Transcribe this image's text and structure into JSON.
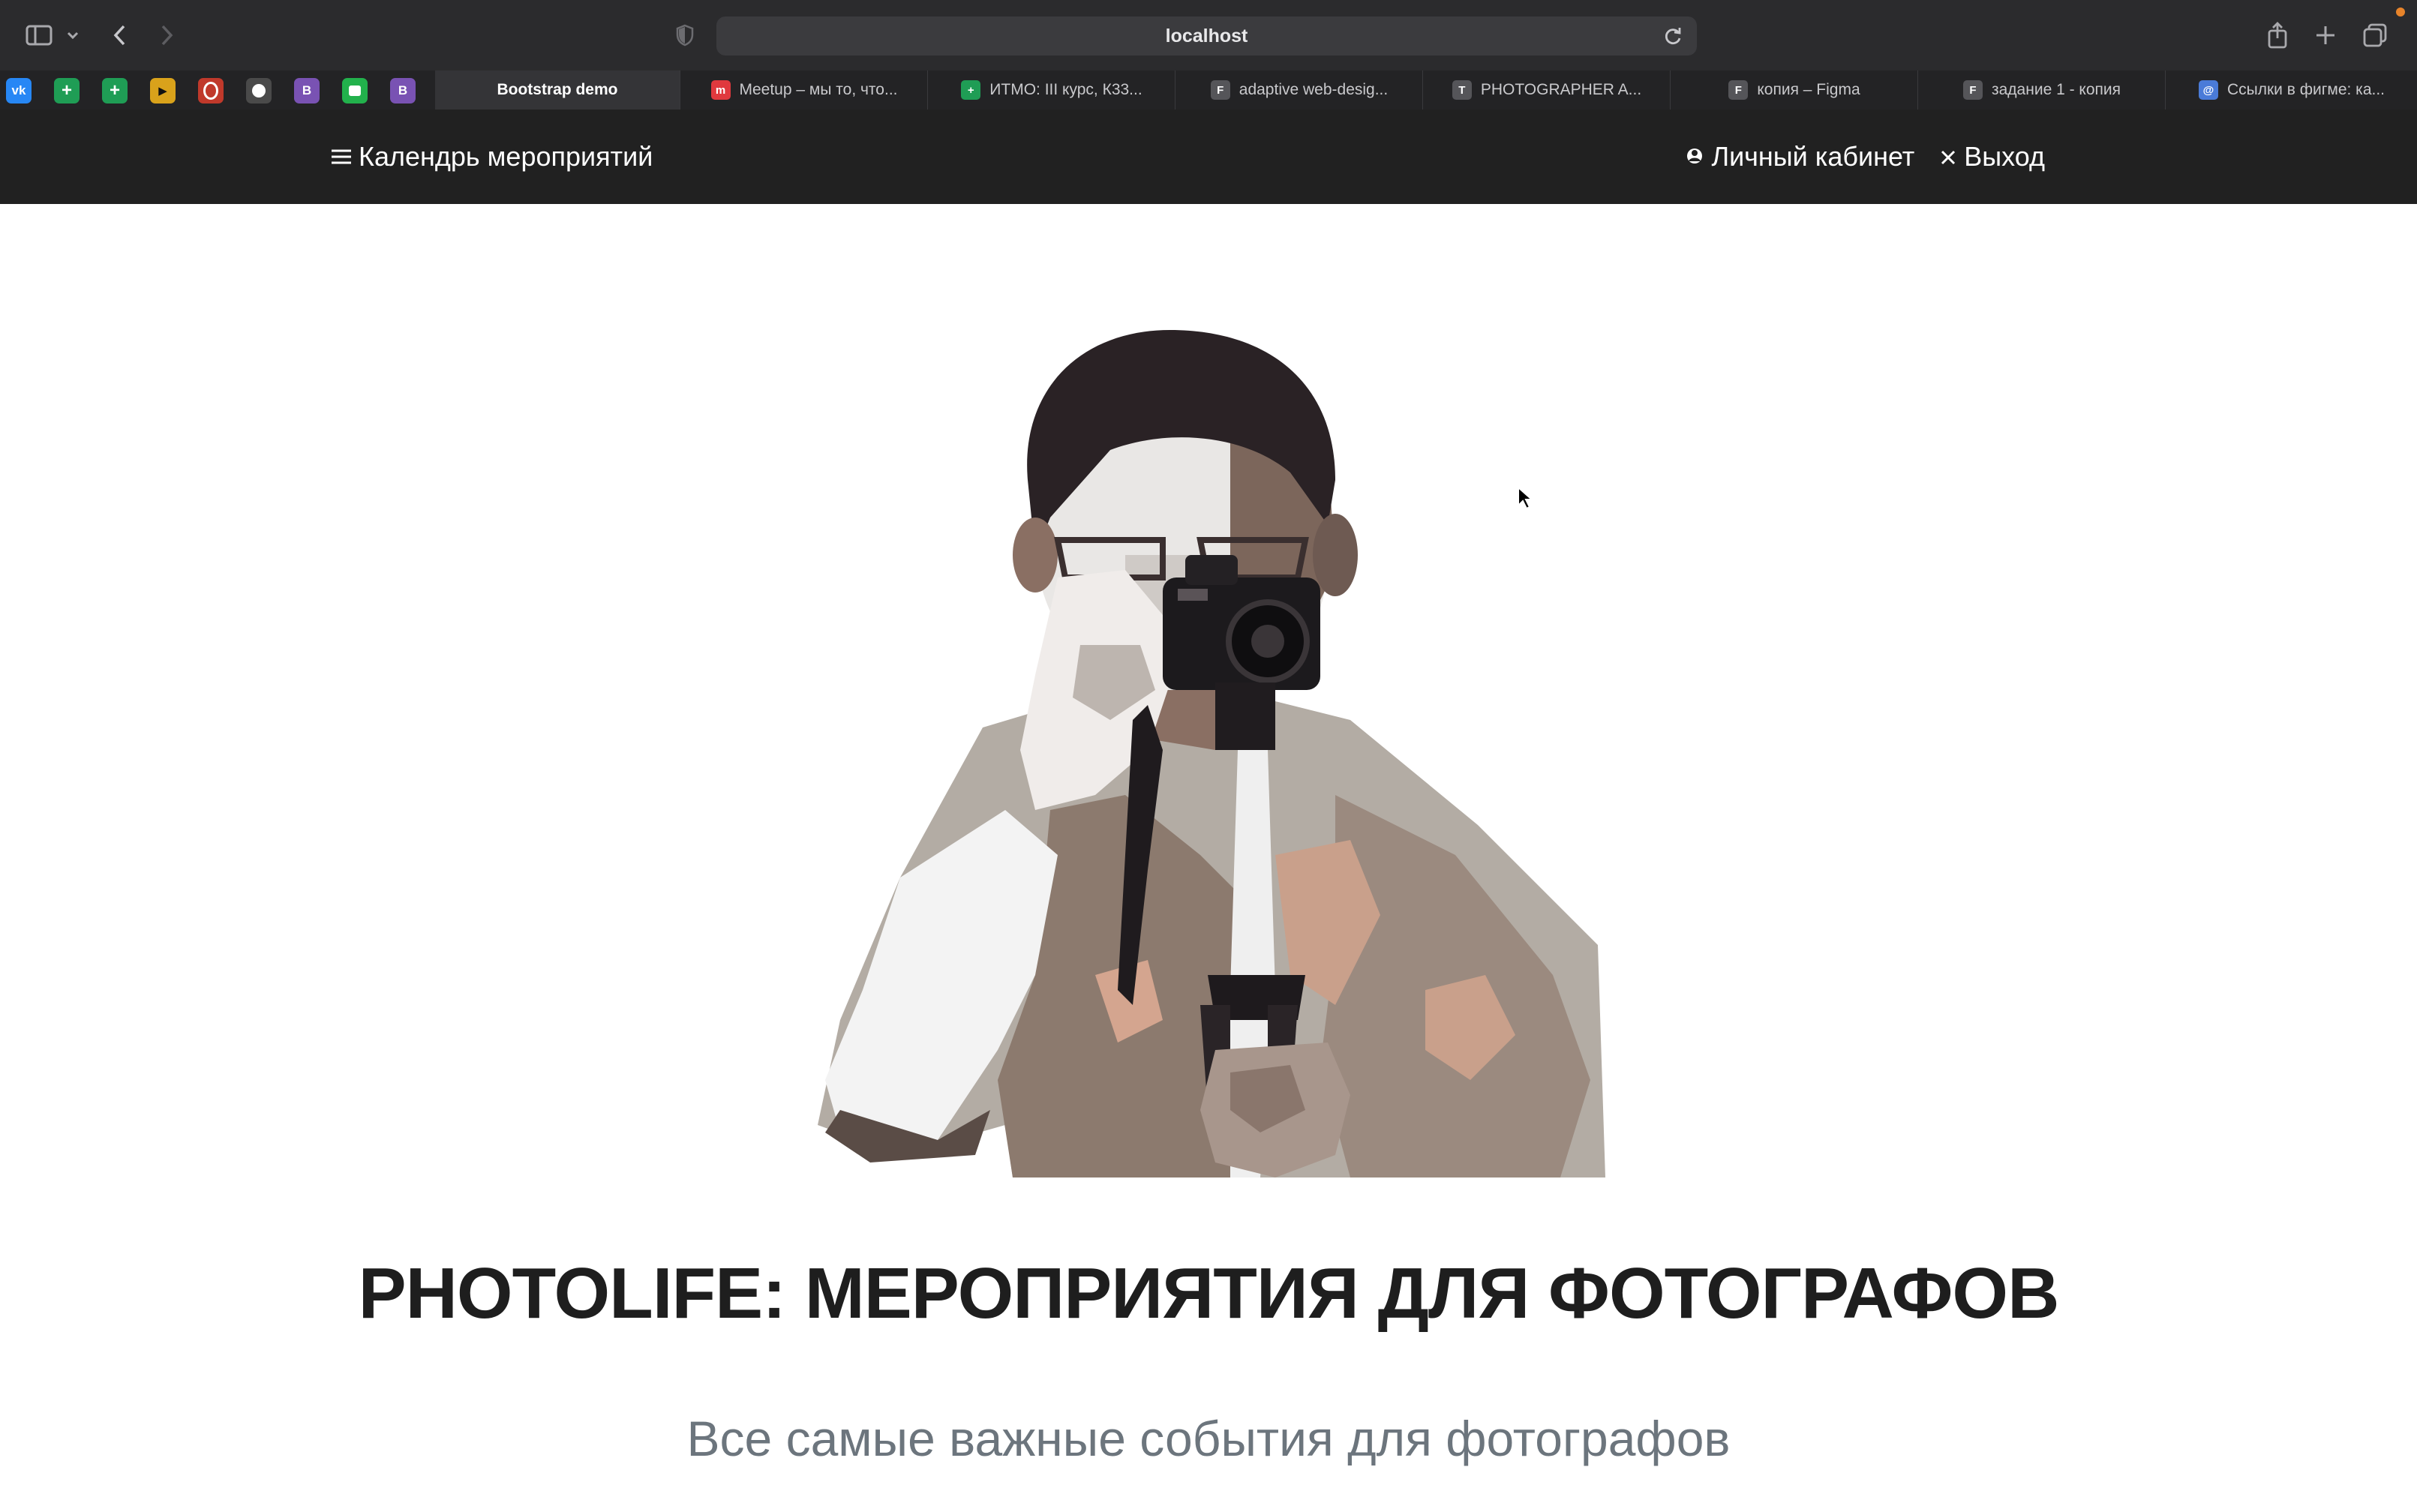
{
  "browser": {
    "url": "localhost",
    "pinned_tabs": [
      {
        "icon": "vk-icon",
        "label": "vk",
        "color": "#2787f5"
      },
      {
        "icon": "google-sheets-icon",
        "label": "",
        "color": "#1f9d55"
      },
      {
        "icon": "google-sheets-icon",
        "label": "",
        "color": "#1f9d55"
      },
      {
        "icon": "video-icon",
        "label": "",
        "color": "#d9a21b"
      },
      {
        "icon": "opera-icon",
        "label": "",
        "color": "#c0392b"
      },
      {
        "icon": "github-icon",
        "label": "",
        "color": "#4a4a4a"
      },
      {
        "icon": "bootstrap-icon",
        "label": "B",
        "color": "#7952b3"
      },
      {
        "icon": "chat-icon",
        "label": "",
        "color": "#22b14c"
      },
      {
        "icon": "bootstrap-icon",
        "label": "B",
        "color": "#7952b3"
      }
    ],
    "tabs": [
      {
        "label": "Bootstrap demo",
        "icon": "",
        "active": true
      },
      {
        "label": "Meetup – мы то, что...",
        "icon": "meetup-icon",
        "icon_color": "#e0393e"
      },
      {
        "label": "ИТМО: III курс, К33...",
        "icon": "google-sheets-icon",
        "icon_color": "#1f9d55"
      },
      {
        "label": "adaptive web-desig...",
        "icon": "figma-icon",
        "icon_color": "#555559"
      },
      {
        "label": "PHOTOGRAPHER A...",
        "icon": "site-icon",
        "icon_color": "#555559"
      },
      {
        "label": "копия – Figma",
        "icon": "figma-icon",
        "icon_color": "#555559"
      },
      {
        "label": "задание 1 - копия",
        "icon": "figma-icon",
        "icon_color": "#555559"
      },
      {
        "label": "Ссылки в фигме: ка...",
        "icon": "link-icon",
        "icon_color": "#4a7bd8"
      }
    ]
  },
  "navbar": {
    "brand": "Календрь мероприятий",
    "account": "Личный кабинет",
    "logout": "Выход"
  },
  "hero": {
    "image": "photographer-illustration",
    "title": "PHOTOLIFE: МЕРОПРИЯТИЯ ДЛЯ ФОТОГРАФОВ",
    "subtitle": "Все самые важные события для фотографов"
  }
}
